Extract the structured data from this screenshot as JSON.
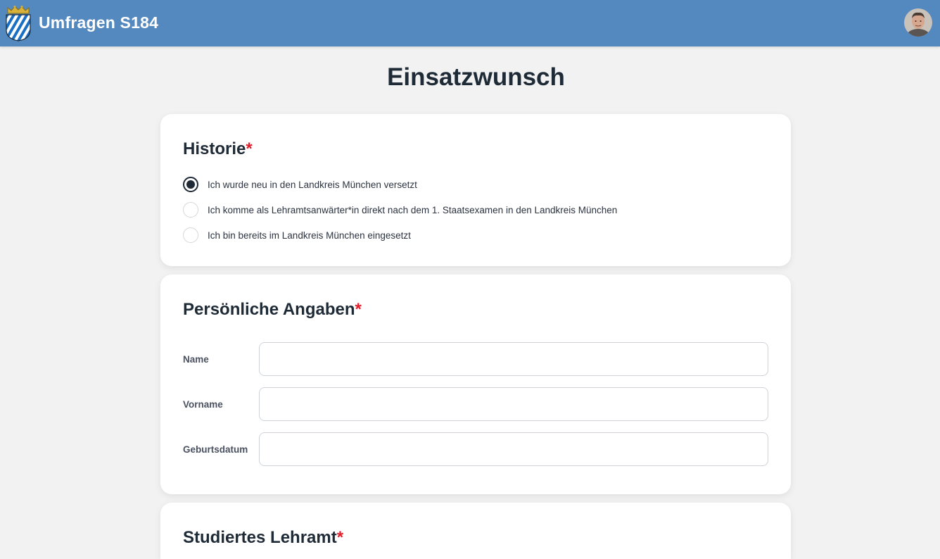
{
  "header": {
    "app_title": "Umfragen S184",
    "logo_icon": "bavaria-coat-of-arms-icon",
    "avatar_icon": "user-avatar",
    "bg_color": "#5489c0"
  },
  "page": {
    "title": "Einsatzwunsch"
  },
  "sections": {
    "historie": {
      "title": "Historie",
      "required_mark": "*",
      "options": [
        {
          "label": "Ich wurde neu in den Landkreis München versetzt",
          "selected": true
        },
        {
          "label": "Ich komme als Lehramtsanwärter*in direkt nach dem 1. Staatsexamen in den Landkreis München",
          "selected": false
        },
        {
          "label": "Ich bin bereits im Landkreis München eingesetzt",
          "selected": false
        }
      ]
    },
    "personal": {
      "title": "Persönliche Angaben",
      "required_mark": "*",
      "fields": [
        {
          "label": "Name",
          "value": ""
        },
        {
          "label": "Vorname",
          "value": ""
        },
        {
          "label": "Geburtsdatum",
          "value": ""
        }
      ]
    },
    "lehramt": {
      "title": "Studiertes Lehramt",
      "required_mark": "*"
    }
  },
  "colors": {
    "accent": "#5489c0",
    "required": "#e11d2a",
    "text": "#1f2a37"
  }
}
